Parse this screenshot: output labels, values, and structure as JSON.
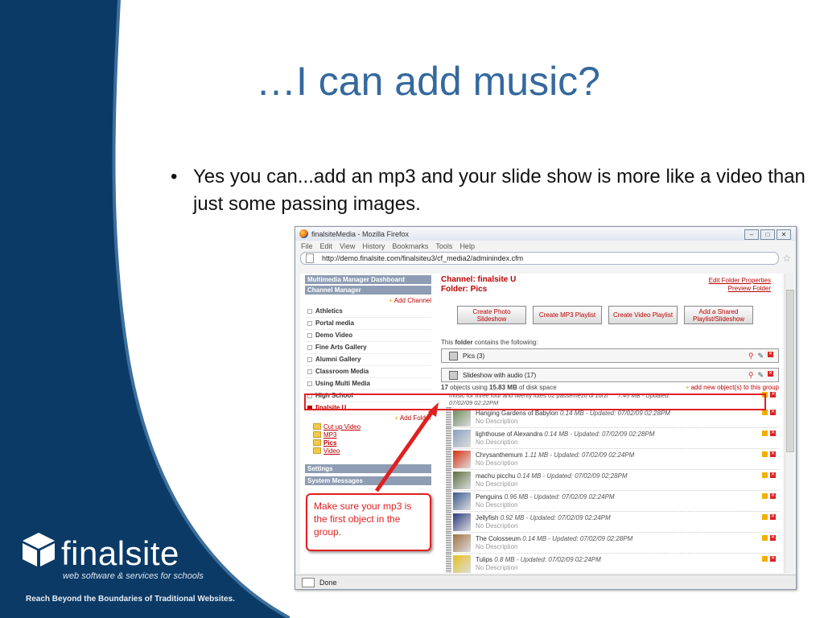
{
  "slide": {
    "title": "…I can add music?",
    "bullet": "Yes you can...add an mp3 and your slide show is more like a video than just some passing images."
  },
  "brand": {
    "logo_word": "finalsite",
    "logo_sub": "web software & services for schools",
    "tagline": "Reach Beyond the Boundaries of Traditional Websites."
  },
  "browser": {
    "title": "finalsiteMedia - Mozilla Firefox",
    "menu": [
      "File",
      "Edit",
      "View",
      "History",
      "Bookmarks",
      "Tools",
      "Help"
    ],
    "url": "http://demo.finalsite.com/finalsiteu3/cf_media2/adminindex.cfm",
    "status": "Done"
  },
  "sidebar": {
    "dashboard": "Multimedia Manager Dashboard",
    "channel_manager": "Channel Manager",
    "add_channel": "Add Channel",
    "channels": [
      "Athletics",
      "Portal media",
      "Demo Video",
      "Fine Arts Gallery",
      "Alumni Gallery",
      "Classroom Media",
      "Using Multi Media",
      "High School",
      "finalsite U"
    ],
    "add_folder": "Add Folder",
    "folders": [
      "Cut up Video",
      "MP3",
      "Pics",
      "Video"
    ],
    "settings": "Settings",
    "system_messages": "System Messages"
  },
  "main": {
    "channel": "Channel: finalsite U",
    "folder": "Folder: Pics",
    "edit_folder": "Edit Folder Properties",
    "preview_folder": "Preview Folder",
    "buttons": [
      "Create Photo Slideshow",
      "Create MP3 Playlist",
      "Create Video Playlist",
      "Add a Shared Playlist/Slideshow"
    ],
    "contains_pre": "This ",
    "contains_bold": "folder",
    "contains_post": " contains the following:",
    "groups": [
      "Pics (3)",
      "Slideshow with audio (17)"
    ],
    "objects_count": "17",
    "objects_mid": " objects using ",
    "objects_size": "15.83 MB",
    "objects_post": " of disk space",
    "add_objects": "add new object(s) to this group",
    "mp3_item": "music for three four and twenty lutes 02 passemezo di zorzi",
    "mp3_meta": "7.45 MB - Updated:",
    "mp3_date": "07/02/09 02:22PM",
    "items": [
      {
        "title": "Hanging Gardens of Babylon",
        "meta": "0.14 MB - Updated: 07/02/09 02:28PM",
        "desc": "No Description",
        "color": "#6a8a5a"
      },
      {
        "title": "lighthouse of Alexandra",
        "meta": "0.14 MB - Updated: 07/02/09 02:28PM",
        "desc": "No Description",
        "color": "#8aa0c0"
      },
      {
        "title": "Chrysanthemum",
        "meta": "1.11 MB - Updated: 07/02/09 02:24PM",
        "desc": "No Description",
        "color": "#d83010"
      },
      {
        "title": "machu picchu",
        "meta": "0.14 MB - Updated: 07/02/09 02:28PM",
        "desc": "No Description",
        "color": "#5a7040"
      },
      {
        "title": "Penguins",
        "meta": "0.96 MB - Updated: 07/02/09 02:24PM",
        "desc": "No Description",
        "color": "#3a5a90"
      },
      {
        "title": "Jellyfish",
        "meta": "0.92 MB - Updated: 07/02/09 02:24PM",
        "desc": "No Description",
        "color": "#2a3a80"
      },
      {
        "title": "The Colosseum",
        "meta": "0.14 MB - Updated: 07/02/09 02:28PM",
        "desc": "No Description",
        "color": "#a07040"
      },
      {
        "title": "Tulips",
        "meta": "0.8 MB - Updated: 07/02/09 02:24PM",
        "desc": "No Description",
        "color": "#e8c020"
      }
    ]
  },
  "callout": "Make sure your mp3 is the first object in the group.",
  "colors": {
    "slide_blue": "#0c3a66",
    "title_blue": "#35699e",
    "accent_red": "#e02020"
  }
}
